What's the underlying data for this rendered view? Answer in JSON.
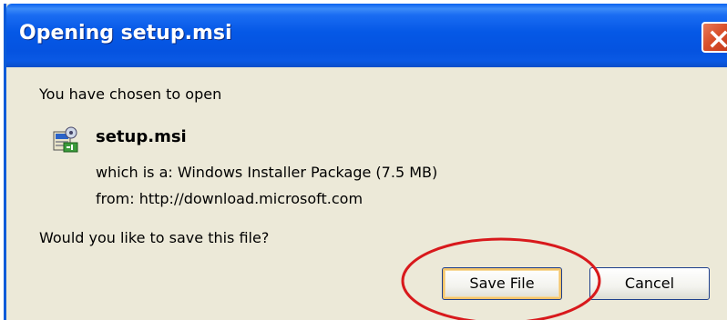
{
  "dialog": {
    "title": "Opening setup.msi",
    "intro": "You have chosen to open",
    "file": {
      "name": "setup.msi",
      "icon": "installer-package-icon"
    },
    "type_line": "which is a:  Windows Installer Package (7.5 MB)",
    "from_line": "from:  http://download.microsoft.com",
    "question": "Would you like to save this file?"
  },
  "buttons": {
    "save_label": "Save File",
    "cancel_label": "Cancel"
  },
  "colors": {
    "titlebar": "#0558e6",
    "dialog_bg": "#ece9d8",
    "close_button": "#d9502a",
    "annotation_ring": "#d8191c",
    "focus_ring": "#f4c46a"
  }
}
